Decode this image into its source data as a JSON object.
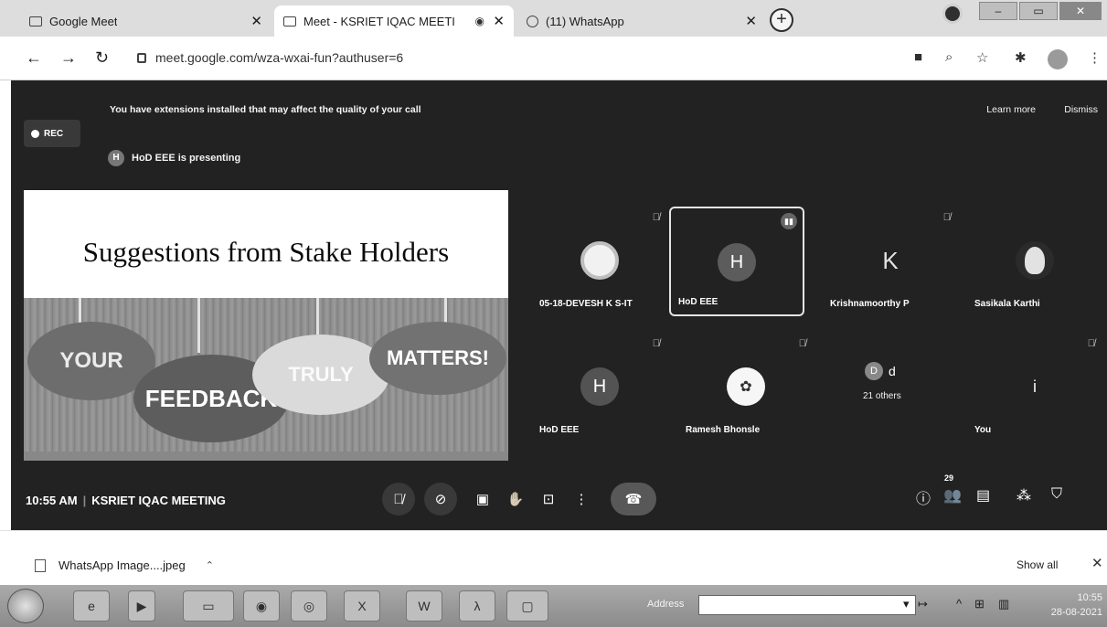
{
  "browser": {
    "tabs": [
      {
        "label": "Google Meet",
        "active": false
      },
      {
        "label": "Meet - KSRIET IQAC MEETI",
        "active": true
      },
      {
        "label": "(11) WhatsApp",
        "active": false
      }
    ],
    "url": "meet.google.com/wza-wxai-fun?authuser=6",
    "icons": [
      "back-icon",
      "forward-icon",
      "reload-icon",
      "lock-icon",
      "camera-icon",
      "zoom-icon",
      "star-icon",
      "extensions-icon",
      "profile-icon",
      "menu-icon"
    ]
  },
  "meet": {
    "extension_warning": "You have extensions installed that may affect the quality of your call",
    "learn_more": "Learn more",
    "dismiss": "Dismiss",
    "rec_label": "REC",
    "presenter_initial": "H",
    "presenting_text": "HoD EEE is presenting",
    "slide": {
      "title": "Suggestions from Stake Holders",
      "words": [
        "YOUR",
        "FEEDBACK",
        "TRULY",
        "MATTERS!"
      ]
    },
    "participants": [
      {
        "name": "05-18-DEVESH K S-IT",
        "initial": "",
        "muted": true
      },
      {
        "name": "HoD EEE",
        "initial": "H",
        "muted": false,
        "speaking": true
      },
      {
        "name": "Krishnamoorthy P",
        "initial": "K",
        "muted": true
      },
      {
        "name": "Sasikala Karthi",
        "initial": "",
        "muted": false
      },
      {
        "name": "HoD EEE",
        "initial": "H",
        "muted": true
      },
      {
        "name": "Ramesh Bhonsle",
        "initial": "",
        "muted": true
      },
      {
        "name": "d",
        "initial": "D",
        "others": "21 others",
        "muted": false
      },
      {
        "name": "You",
        "initial": "i",
        "muted": true
      }
    ],
    "time": "10:55 AM",
    "meeting_name": "KSRIET IQAC MEETING",
    "participant_count": "29"
  },
  "downloads": {
    "file": "WhatsApp Image....jpeg",
    "show_all": "Show all"
  },
  "taskbar": {
    "address_label": "Address",
    "clock_time": "10:55",
    "clock_date": "28-08-2021"
  }
}
